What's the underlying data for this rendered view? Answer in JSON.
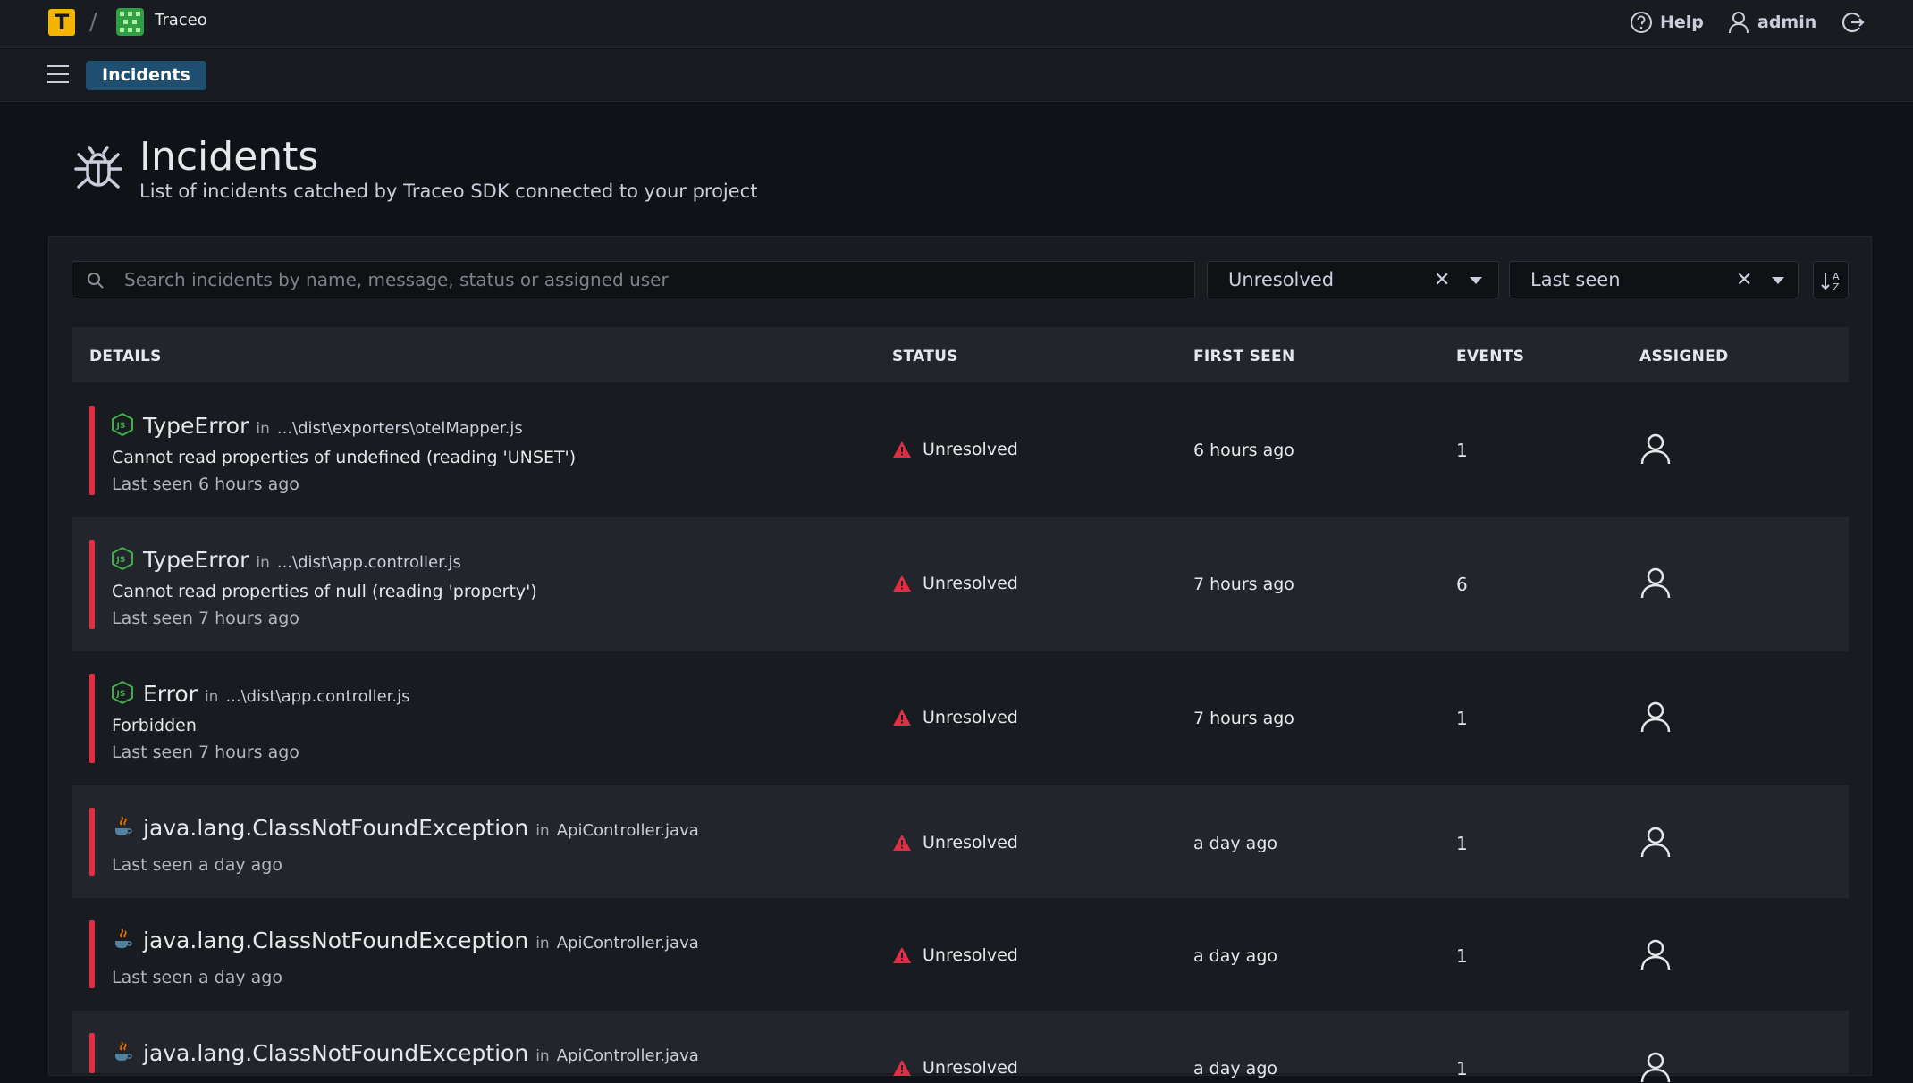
{
  "topbar": {
    "logo_letter": "T",
    "separator": "/",
    "project_name": "Traceo",
    "help_label": "Help",
    "user_label": "admin"
  },
  "breadcrumb": {
    "current": "Incidents"
  },
  "header": {
    "title": "Incidents",
    "subtitle": "List of incidents catched by Traceo SDK connected to your project"
  },
  "filters": {
    "search_placeholder": "Search incidents by name, message, status or assigned user",
    "search_value": "",
    "status_value": "Unresolved",
    "sort_value": "Last seen"
  },
  "table": {
    "columns": [
      "DETAILS",
      "STATUS",
      "FIRST SEEN",
      "EVENTS",
      "ASSIGNED"
    ],
    "rows": [
      {
        "lang_icon": "nodejs-icon",
        "name": "TypeError",
        "in": "in",
        "file": "...\\dist\\exporters\\otelMapper.js",
        "message": "Cannot read properties of undefined (reading 'UNSET')",
        "last_seen": "Last seen 6 hours ago",
        "status": "Unresolved",
        "first_seen": "6 hours ago",
        "events": "1"
      },
      {
        "lang_icon": "nodejs-icon",
        "name": "TypeError",
        "in": "in",
        "file": "...\\dist\\app.controller.js",
        "message": "Cannot read properties of null (reading 'property')",
        "last_seen": "Last seen 7 hours ago",
        "status": "Unresolved",
        "first_seen": "7 hours ago",
        "events": "6"
      },
      {
        "lang_icon": "nodejs-icon",
        "name": "Error",
        "in": "in",
        "file": "...\\dist\\app.controller.js",
        "message": "Forbidden",
        "last_seen": "Last seen 7 hours ago",
        "status": "Unresolved",
        "first_seen": "7 hours ago",
        "events": "1"
      },
      {
        "lang_icon": "java-icon",
        "name": "java.lang.ClassNotFoundException",
        "in": "in",
        "file": "ApiController.java",
        "message": "",
        "last_seen": "Last seen a day ago",
        "status": "Unresolved",
        "first_seen": "a day ago",
        "events": "1"
      },
      {
        "lang_icon": "java-icon",
        "name": "java.lang.ClassNotFoundException",
        "in": "in",
        "file": "ApiController.java",
        "message": "",
        "last_seen": "Last seen a day ago",
        "status": "Unresolved",
        "first_seen": "a day ago",
        "events": "1"
      },
      {
        "lang_icon": "java-icon",
        "name": "java.lang.ClassNotFoundException",
        "in": "in",
        "file": "ApiController.java",
        "message": "",
        "last_seen": "",
        "status": "Unresolved",
        "first_seen": "a day ago",
        "events": "1"
      }
    ]
  },
  "colors": {
    "accent": "#1f4e6e",
    "status_red": "#e02f44",
    "node_green": "#3fae49",
    "logo_yellow": "#f5b400"
  }
}
